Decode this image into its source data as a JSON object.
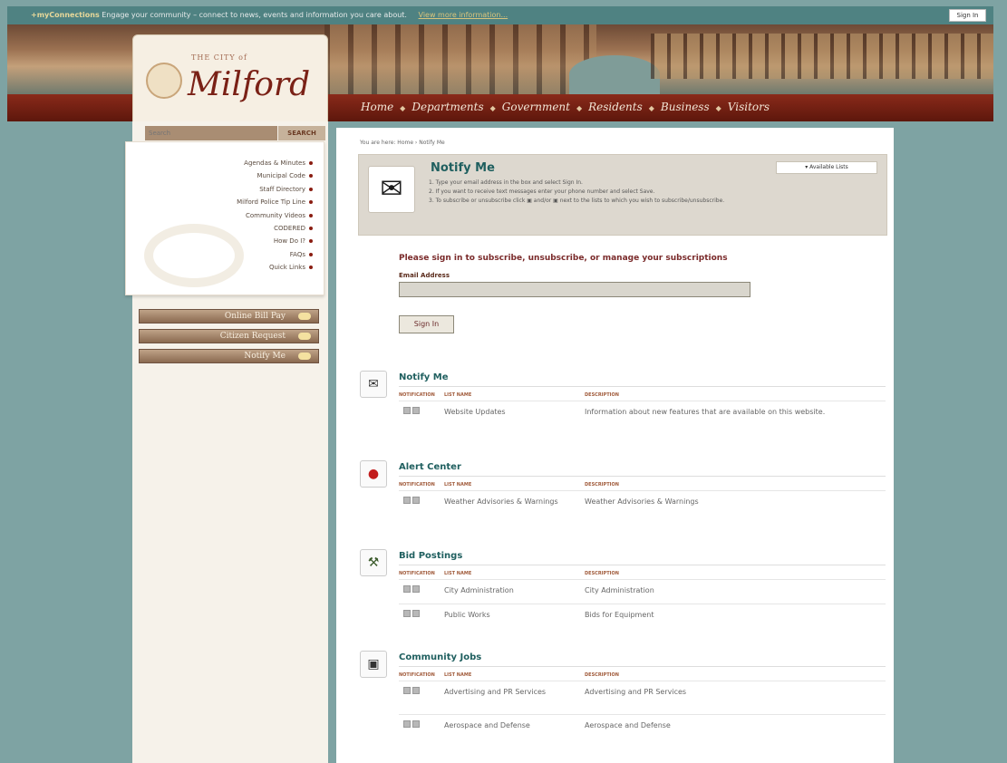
{
  "topbar": {
    "brand": "+myConnections",
    "message": "Engage your community – connect to news, events and information you care about.",
    "more_link": "View more information...",
    "sign_in": "Sign In"
  },
  "logo": {
    "small": "THE CITY of",
    "name": "Milford"
  },
  "nav": {
    "items": [
      "Home",
      "Departments",
      "Government",
      "Residents",
      "Business",
      "Visitors"
    ]
  },
  "sidebar": {
    "search_placeholder": "Search",
    "search_button": "SEARCH",
    "links": [
      "Agendas & Minutes",
      "Municipal Code",
      "Staff Directory",
      "Milford Police Tip Line",
      "Community Videos",
      "CODERED",
      "How Do I?",
      "FAQs",
      "Quick Links"
    ],
    "buttons": [
      "Online Bill Pay",
      "Citizen Request",
      "Notify Me"
    ]
  },
  "breadcrumb": "You are here: Home › Notify Me",
  "banner": {
    "title": "Notify Me",
    "available_lists": "▾ Available Lists",
    "steps": [
      "1.  Type your email address in the box and select Sign In.",
      "2.  If you want to receive text messages enter your phone number and select Save.",
      "3.  To subscribe or unsubscribe click ▣ and/or ▣ next to the lists to which you wish to subscribe/unsubscribe."
    ]
  },
  "signin": {
    "prompt": "Please sign in to subscribe, unsubscribe, or manage your subscriptions",
    "email_label": "Email Address",
    "button": "Sign In"
  },
  "table_headers": [
    "NOTIFICATION",
    "LIST NAME",
    "DESCRIPTION"
  ],
  "sections": [
    {
      "title": "Notify Me",
      "icon": "envelope-icon",
      "rows": [
        {
          "name": "Website Updates",
          "desc": "Information about new features that are available on this website."
        }
      ]
    },
    {
      "title": "Alert Center",
      "icon": "alert-icon",
      "rows": [
        {
          "name": "Weather Advisories & Warnings",
          "desc": "Weather Advisories & Warnings"
        }
      ]
    },
    {
      "title": "Bid Postings",
      "icon": "gavel-icon",
      "rows": [
        {
          "name": "City Administration",
          "desc": "City Administration"
        },
        {
          "name": "Public Works",
          "desc": "Bids for Equipment"
        }
      ]
    },
    {
      "title": "Community Jobs",
      "icon": "briefcase-icon",
      "rows": [
        {
          "name": "Advertising and PR Services",
          "desc": "Advertising and PR Services"
        },
        {
          "name": "Aerospace and Defense",
          "desc": "Aerospace and Defense"
        }
      ]
    }
  ]
}
